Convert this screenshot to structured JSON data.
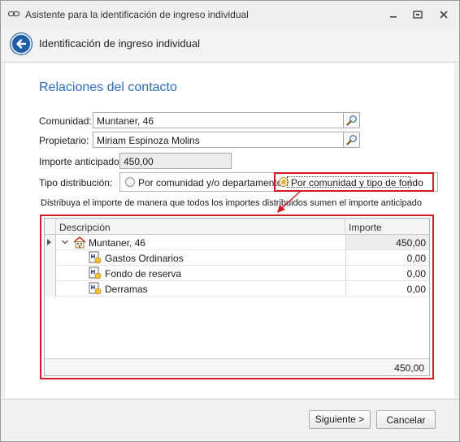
{
  "window": {
    "title": "Asistente para la identificación de ingreso individual",
    "icons": {
      "app": "link-icon",
      "minimize": "minimize-icon",
      "maximize": "maximize-icon",
      "close": "close-icon"
    }
  },
  "header": {
    "title": "Identificación de ingreso individual",
    "back_icon": "back-arrow-icon"
  },
  "section": {
    "title": "Relaciones del contacto"
  },
  "form": {
    "comunidad": {
      "label": "Comunidad:",
      "value": "Muntaner, 46"
    },
    "propietario": {
      "label": "Propietario:",
      "value": "Miriam Espinoza Molins"
    },
    "importe": {
      "label": "Importe anticipado:",
      "value": "450,00"
    },
    "tipo": {
      "label": "Tipo distribución:",
      "options": [
        {
          "label": "Por comunidad y/o departamento",
          "checked": false
        },
        {
          "label": "Por comunidad y tipo de fondo",
          "checked": true
        }
      ]
    },
    "hint": "Distribuya el importe de manera que todos los importes distribuidos sumen el importe anticipado"
  },
  "grid": {
    "columns": [
      "Descripción",
      "Importe"
    ],
    "rows": [
      {
        "desc": "Muntaner, 46",
        "amount": "450,00",
        "level": 0,
        "icon": "building-icon"
      },
      {
        "desc": "Gastos Ordinarios",
        "amount": "0,00",
        "level": 1,
        "icon": "fund-icon"
      },
      {
        "desc": "Fondo de reserva",
        "amount": "0,00",
        "level": 1,
        "icon": "fund-icon"
      },
      {
        "desc": "Derramas",
        "amount": "0,00",
        "level": 1,
        "icon": "fund-icon"
      }
    ],
    "total": "450,00"
  },
  "buttons": {
    "next": "Siguiente >",
    "cancel": "Cancelar"
  },
  "colors": {
    "accent": "#2e6db3",
    "highlight": "#d11a24",
    "back_button": "#1f5da6"
  }
}
